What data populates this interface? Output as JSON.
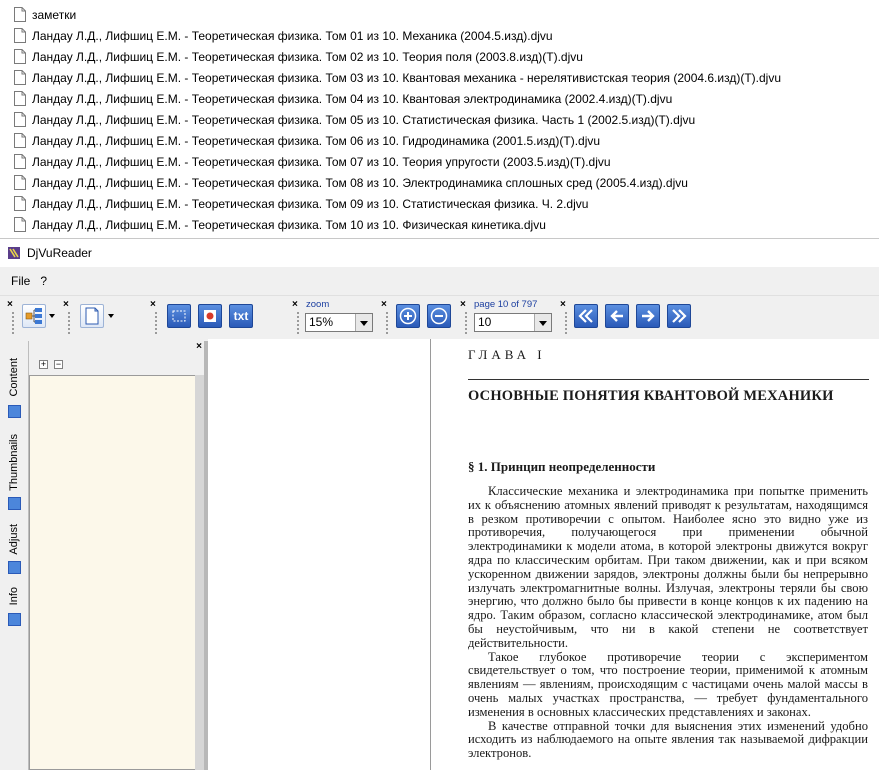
{
  "files": [
    {
      "name": "заметки"
    },
    {
      "name": "Ландау Л.Д., Лифшиц Е.М. - Теоретическая физика. Том 01 из 10. Механика (2004.5.изд).djvu"
    },
    {
      "name": "Ландау Л.Д., Лифшиц Е.М. - Теоретическая физика. Том 02 из 10. Теория поля (2003.8.изд)(Т).djvu"
    },
    {
      "name": "Ландау Л.Д., Лифшиц Е.М. - Теоретическая физика. Том 03 из 10. Квантовая механика - нерелятивистская теория (2004.6.изд)(Т).djvu"
    },
    {
      "name": "Ландау Л.Д., Лифшиц Е.М. - Теоретическая физика. Том 04 из 10. Квантовая электродинамика (2002.4.изд)(Т).djvu"
    },
    {
      "name": "Ландау Л.Д., Лифшиц Е.М. - Теоретическая физика. Том 05 из 10. Статистическая физика. Часть 1 (2002.5.изд)(Т).djvu"
    },
    {
      "name": "Ландау Л.Д., Лифшиц Е.М. - Теоретическая физика. Том 06 из 10. Гидродинамика (2001.5.изд)(Т).djvu"
    },
    {
      "name": "Ландау Л.Д., Лифшиц Е.М. - Теоретическая физика. Том 07 из 10. Теория упругости (2003.5.изд)(Т).djvu"
    },
    {
      "name": "Ландау Л.Д., Лифшиц Е.М. - Теоретическая физика. Том 08 из 10. Электродинамика сплошных сред (2005.4.изд).djvu"
    },
    {
      "name": "Ландау Л.Д., Лифшиц Е.М. - Теоретическая физика. Том 09 из 10. Статистическая физика. Ч. 2.djvu"
    },
    {
      "name": "Ландау Л.Д., Лифшиц Е.М. - Теоретическая физика. Том 10 из 10. Физическая кинетика.djvu"
    }
  ],
  "window": {
    "title": "DjVuReader"
  },
  "menu": {
    "file": "File",
    "help": "?"
  },
  "toolbar": {
    "zoom_label": "zoom",
    "zoom_value": "15%",
    "page_label": "page 10 of 797",
    "page_value": "10",
    "text_button": "txt"
  },
  "side_tabs": {
    "content": "Content",
    "thumbnails": "Thumbnails",
    "adjust": "Adjust",
    "info": "Info"
  },
  "panel": {
    "expand": "+",
    "collapse": "−"
  },
  "page": {
    "chapter_label": "ГЛАВА I",
    "chapter_title": "ОСНОВНЫЕ ПОНЯТИЯ КВАНТОВОЙ МЕХАНИКИ",
    "section_title": "§ 1. Принцип неопределенности",
    "paragraph_1": "Классические механика и электродинамика при попытке применить их к объяснению атомных явлений приводят к результатам, находящимся в резком противоречии с опытом. Наиболее ясно это видно уже из противоречия, получающегося при применении обычной электродинамики к модели атома, в которой электроны движутся вокруг ядра по классическим орбитам. При таком движении, как и при всяком ускоренном движении зарядов, электроны должны были бы непрерывно излучать электромагнитные волны. Излучая, электроны теряли бы свою энергию, что должно было бы привести в конце концов к их падению на ядро. Таким образом, согласно классической электродинамике, атом был бы неустойчивым, что ни в какой степени не соответствует действительности.",
    "paragraph_2": "Такое глубокое противоречие теории с экспериментом свидетельствует о том, что построение теории, применимой к атомным явлениям — явлениям, происходящим с частицами очень малой массы в очень малых участках пространства, — требует фундаментального изменения в основных классических представлениях и законах.",
    "paragraph_3": "В качестве отправной точки для выяснения этих изменений удобно исходить из наблюдаемого на опыте явления так называемой дифракции электронов."
  }
}
